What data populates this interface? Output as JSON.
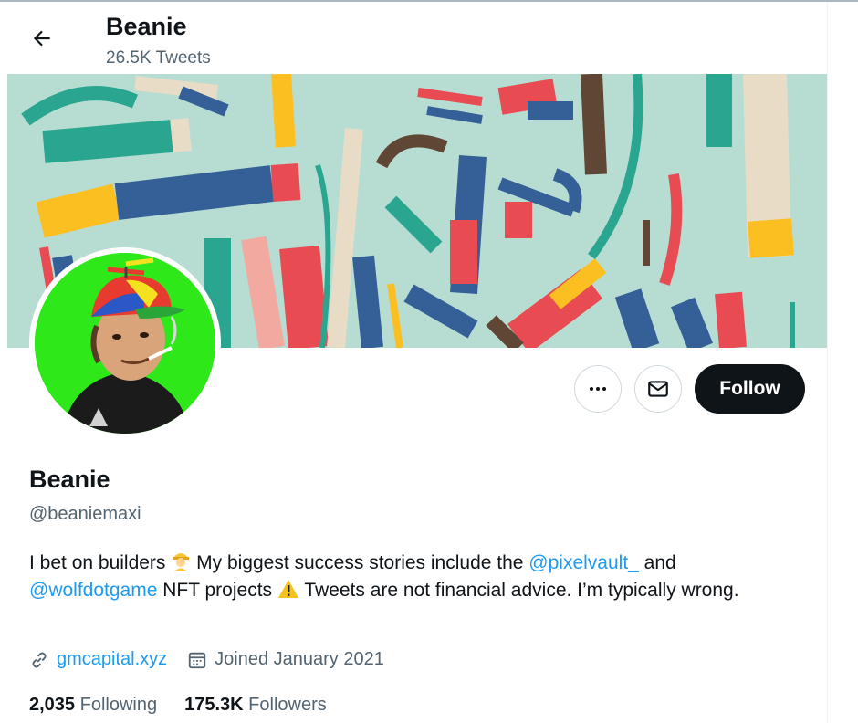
{
  "header": {
    "title": "Beanie",
    "tweets_count": "26.5K Tweets"
  },
  "profile": {
    "name": "Beanie",
    "handle": "@beaniemaxi",
    "bio": {
      "part1": "I bet on builders",
      "part2": " My biggest success stories include the ",
      "mention1": "@pixelvault_",
      "part3": " and",
      "mention2": "@wolfdotgame",
      "part4": " NFT projects ",
      "part5": "Tweets are not financial advice. I’m typically wrong."
    },
    "website": "gmcapital.xyz",
    "joined": "Joined January 2021",
    "following_count": "2,035",
    "following_label": "Following",
    "followers_count": "175.3K",
    "followers_label": "Followers"
  },
  "actions": {
    "follow_label": "Follow"
  },
  "colors": {
    "accent": "#1d9bf0",
    "banner_bg": "#b7ddd3",
    "avatar_bg": "#2fe81a"
  }
}
